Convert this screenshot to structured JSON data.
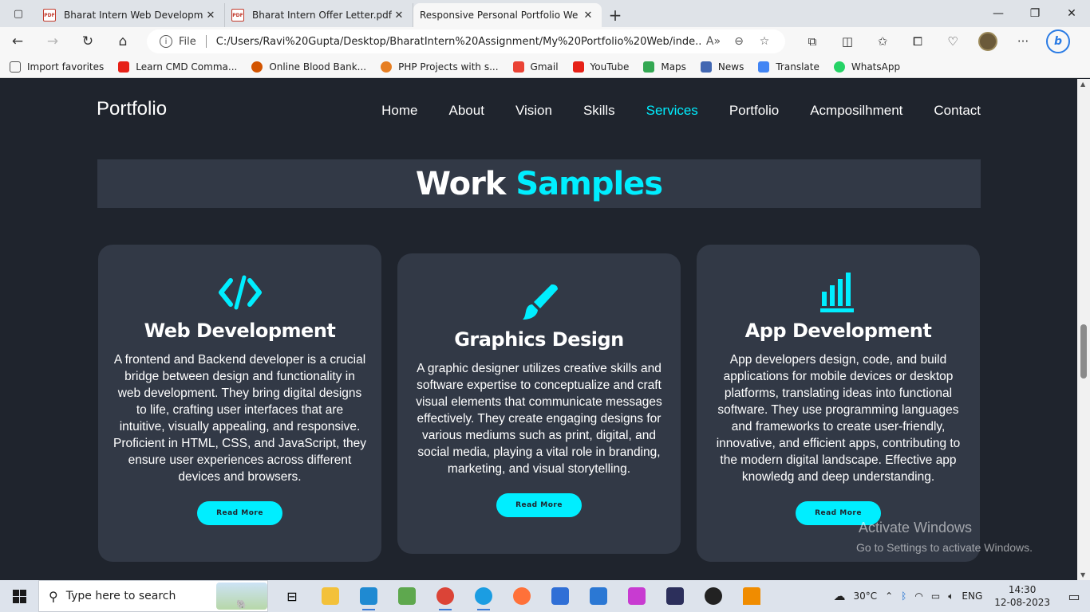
{
  "browser": {
    "tabs": [
      {
        "title": "Bharat Intern Web Development",
        "icon": "pdf-icon"
      },
      {
        "title": "Bharat Intern Offer Letter.pdf",
        "icon": "pdf-icon"
      },
      {
        "title": "Responsive Personal Portfolio We",
        "icon": "page-icon"
      }
    ],
    "url_scheme": "File",
    "url": "C:/Users/Ravi%20Gupta/Desktop/BharatIntern%20Assignment/My%20Portfolio%20Web/inde...",
    "favorites": [
      {
        "label": "Import favorites",
        "color": "#555555"
      },
      {
        "label": "Learn CMD Comma...",
        "color": "#e62117"
      },
      {
        "label": "Online Blood Bank...",
        "color": "#d35400"
      },
      {
        "label": "PHP Projects with s...",
        "color": "#e67e22"
      },
      {
        "label": "Gmail",
        "color": "#ea4335"
      },
      {
        "label": "YouTube",
        "color": "#e62117"
      },
      {
        "label": "Maps",
        "color": "#34a853"
      },
      {
        "label": "News",
        "color": "#4267b2"
      },
      {
        "label": "Translate",
        "color": "#4285f4"
      },
      {
        "label": "WhatsApp",
        "color": "#25d366"
      }
    ]
  },
  "site": {
    "logo": "Portfolio",
    "nav": [
      "Home",
      "About",
      "Vision",
      "Skills",
      "Services",
      "Portfolio",
      "Acmposilhment",
      "Contact"
    ],
    "active_nav": "Services",
    "heading_main": "Work",
    "heading_accent": "Samples",
    "accent_color": "#00eeff",
    "cards": [
      {
        "icon": "code-icon",
        "title": "Web Development",
        "text": "A frontend and Backend developer is a crucial bridge between design and functionality in web development. They bring digital designs to life, crafting user interfaces that are intuitive, visually appealing, and responsive. Proficient in HTML, CSS, and JavaScript, they ensure user experiences across different devices and browsers.",
        "button": "Read More"
      },
      {
        "icon": "paintbrush-icon",
        "title": "Graphics Design",
        "text": "A graphic designer utilizes creative skills and software expertise to conceptualize and craft visual elements that communicate messages effectively. They create engaging designs for various mediums such as print, digital, and social media, playing a vital role in branding, marketing, and visual storytelling.",
        "button": "Read More"
      },
      {
        "icon": "bar-chart-icon",
        "title": "App Development",
        "text": "App developers design, code, and build applications for mobile devices or desktop platforms, translating ideas into functional software. They use programming languages and frameworks to create user-friendly, innovative, and efficient apps, contributing to the modern digital landscape. Effective app knowledg and deep understanding.",
        "button": "Read More"
      }
    ]
  },
  "watermark": {
    "line1": "Activate Windows",
    "line2": "Go to Settings to activate Windows."
  },
  "taskbar": {
    "search_placeholder": "Type here to search",
    "temperature": "30°C",
    "language": "ENG",
    "time": "14:30",
    "date": "12-08-2023"
  }
}
